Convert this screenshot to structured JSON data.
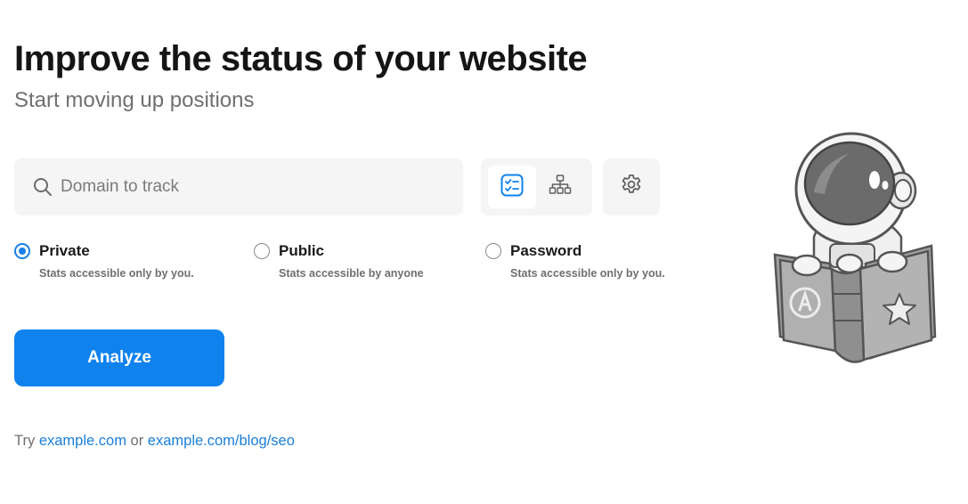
{
  "header": {
    "title": "Improve the status of your website",
    "subtitle": "Start moving up positions"
  },
  "search": {
    "icon": "search-icon",
    "placeholder": "Domain to track",
    "value": ""
  },
  "view_toggle": {
    "options": [
      {
        "icon": "checklist-icon",
        "active": true
      },
      {
        "icon": "sitemap-icon",
        "active": false
      }
    ]
  },
  "settings": {
    "icon": "gear-icon"
  },
  "visibility": {
    "selected": "Private",
    "options": [
      {
        "label": "Private",
        "description": "Stats accessible only by you.",
        "checked": true
      },
      {
        "label": "Public",
        "description": "Stats accessible by anyone",
        "checked": false
      },
      {
        "label": "Password",
        "description": "Stats accessible only by you.",
        "checked": false
      }
    ]
  },
  "analyze_button": {
    "label": "Analyze"
  },
  "examples": {
    "prefix": "Try",
    "link1": "example.com",
    "separator": "or",
    "link2": "example.com/blog/seo"
  },
  "illustration": {
    "icon": "astronaut-reading-book-illustration"
  },
  "colors": {
    "accent": "#0f82ee",
    "link": "#1a7fd8",
    "input_bg": "#f5f5f5",
    "muted_text": "#6f6f6f"
  }
}
